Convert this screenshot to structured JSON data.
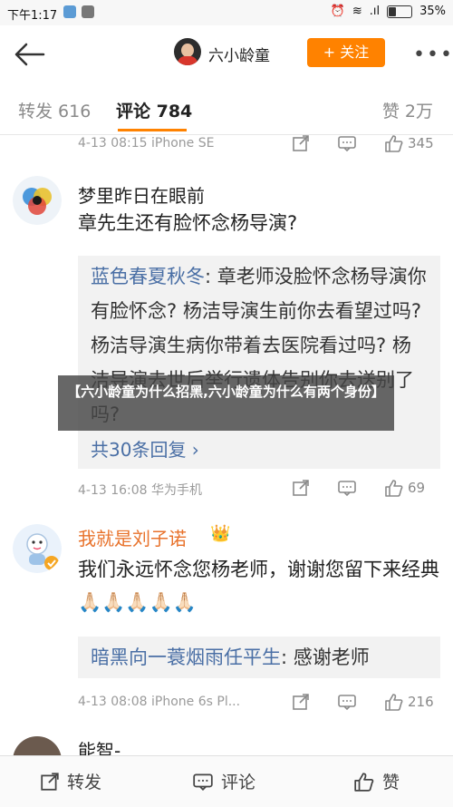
{
  "status_bar": {
    "time": "下午1:17",
    "battery": "35%",
    "battery_level": 0.35,
    "signal": ".ıl"
  },
  "header": {
    "author": "六小龄童",
    "follow_label": "+ 关注",
    "more": "•••"
  },
  "tabs": {
    "repost": "转发 616",
    "comment": "评论 784",
    "like": "赞 2万"
  },
  "comments": [
    {
      "meta": "4-13 08:15  iPhone SE",
      "count": "345"
    },
    {
      "user": "梦里昨日在眼前",
      "text": "章先生还有脸怀念杨导演?",
      "reply_user": "蓝色春夏秋冬",
      "reply_text": ": 章老师没脸怀念杨导演你有脸怀念? 杨洁导演生前你去看望过吗? 杨洁导演生病你带着去医院看过吗? 杨洁导演去世后举行遗体告别你去送别了吗?",
      "reply_more": "共30条回复 ›",
      "meta": "4-13 16:08  华为手机",
      "count": "69"
    },
    {
      "user": "我就是刘子诺",
      "text": "我们永远怀念您杨老师，谢谢您留下来经典🙏🏻🙏🏻🙏🏻🙏🏻🙏🏻",
      "reply_user": "暗黑向一蓑烟雨任平生",
      "reply_text": ": 感谢老师",
      "meta": "4-13 08:08  iPhone 6s Pl...",
      "count": "216"
    },
    {
      "user": "能智-"
    }
  ],
  "overlay": {
    "text": "【六小龄童为什么招黑,六小龄童为什么有两个身份】"
  },
  "bottom_bar": {
    "repost": "转发",
    "comment": "评论",
    "like": "赞"
  }
}
